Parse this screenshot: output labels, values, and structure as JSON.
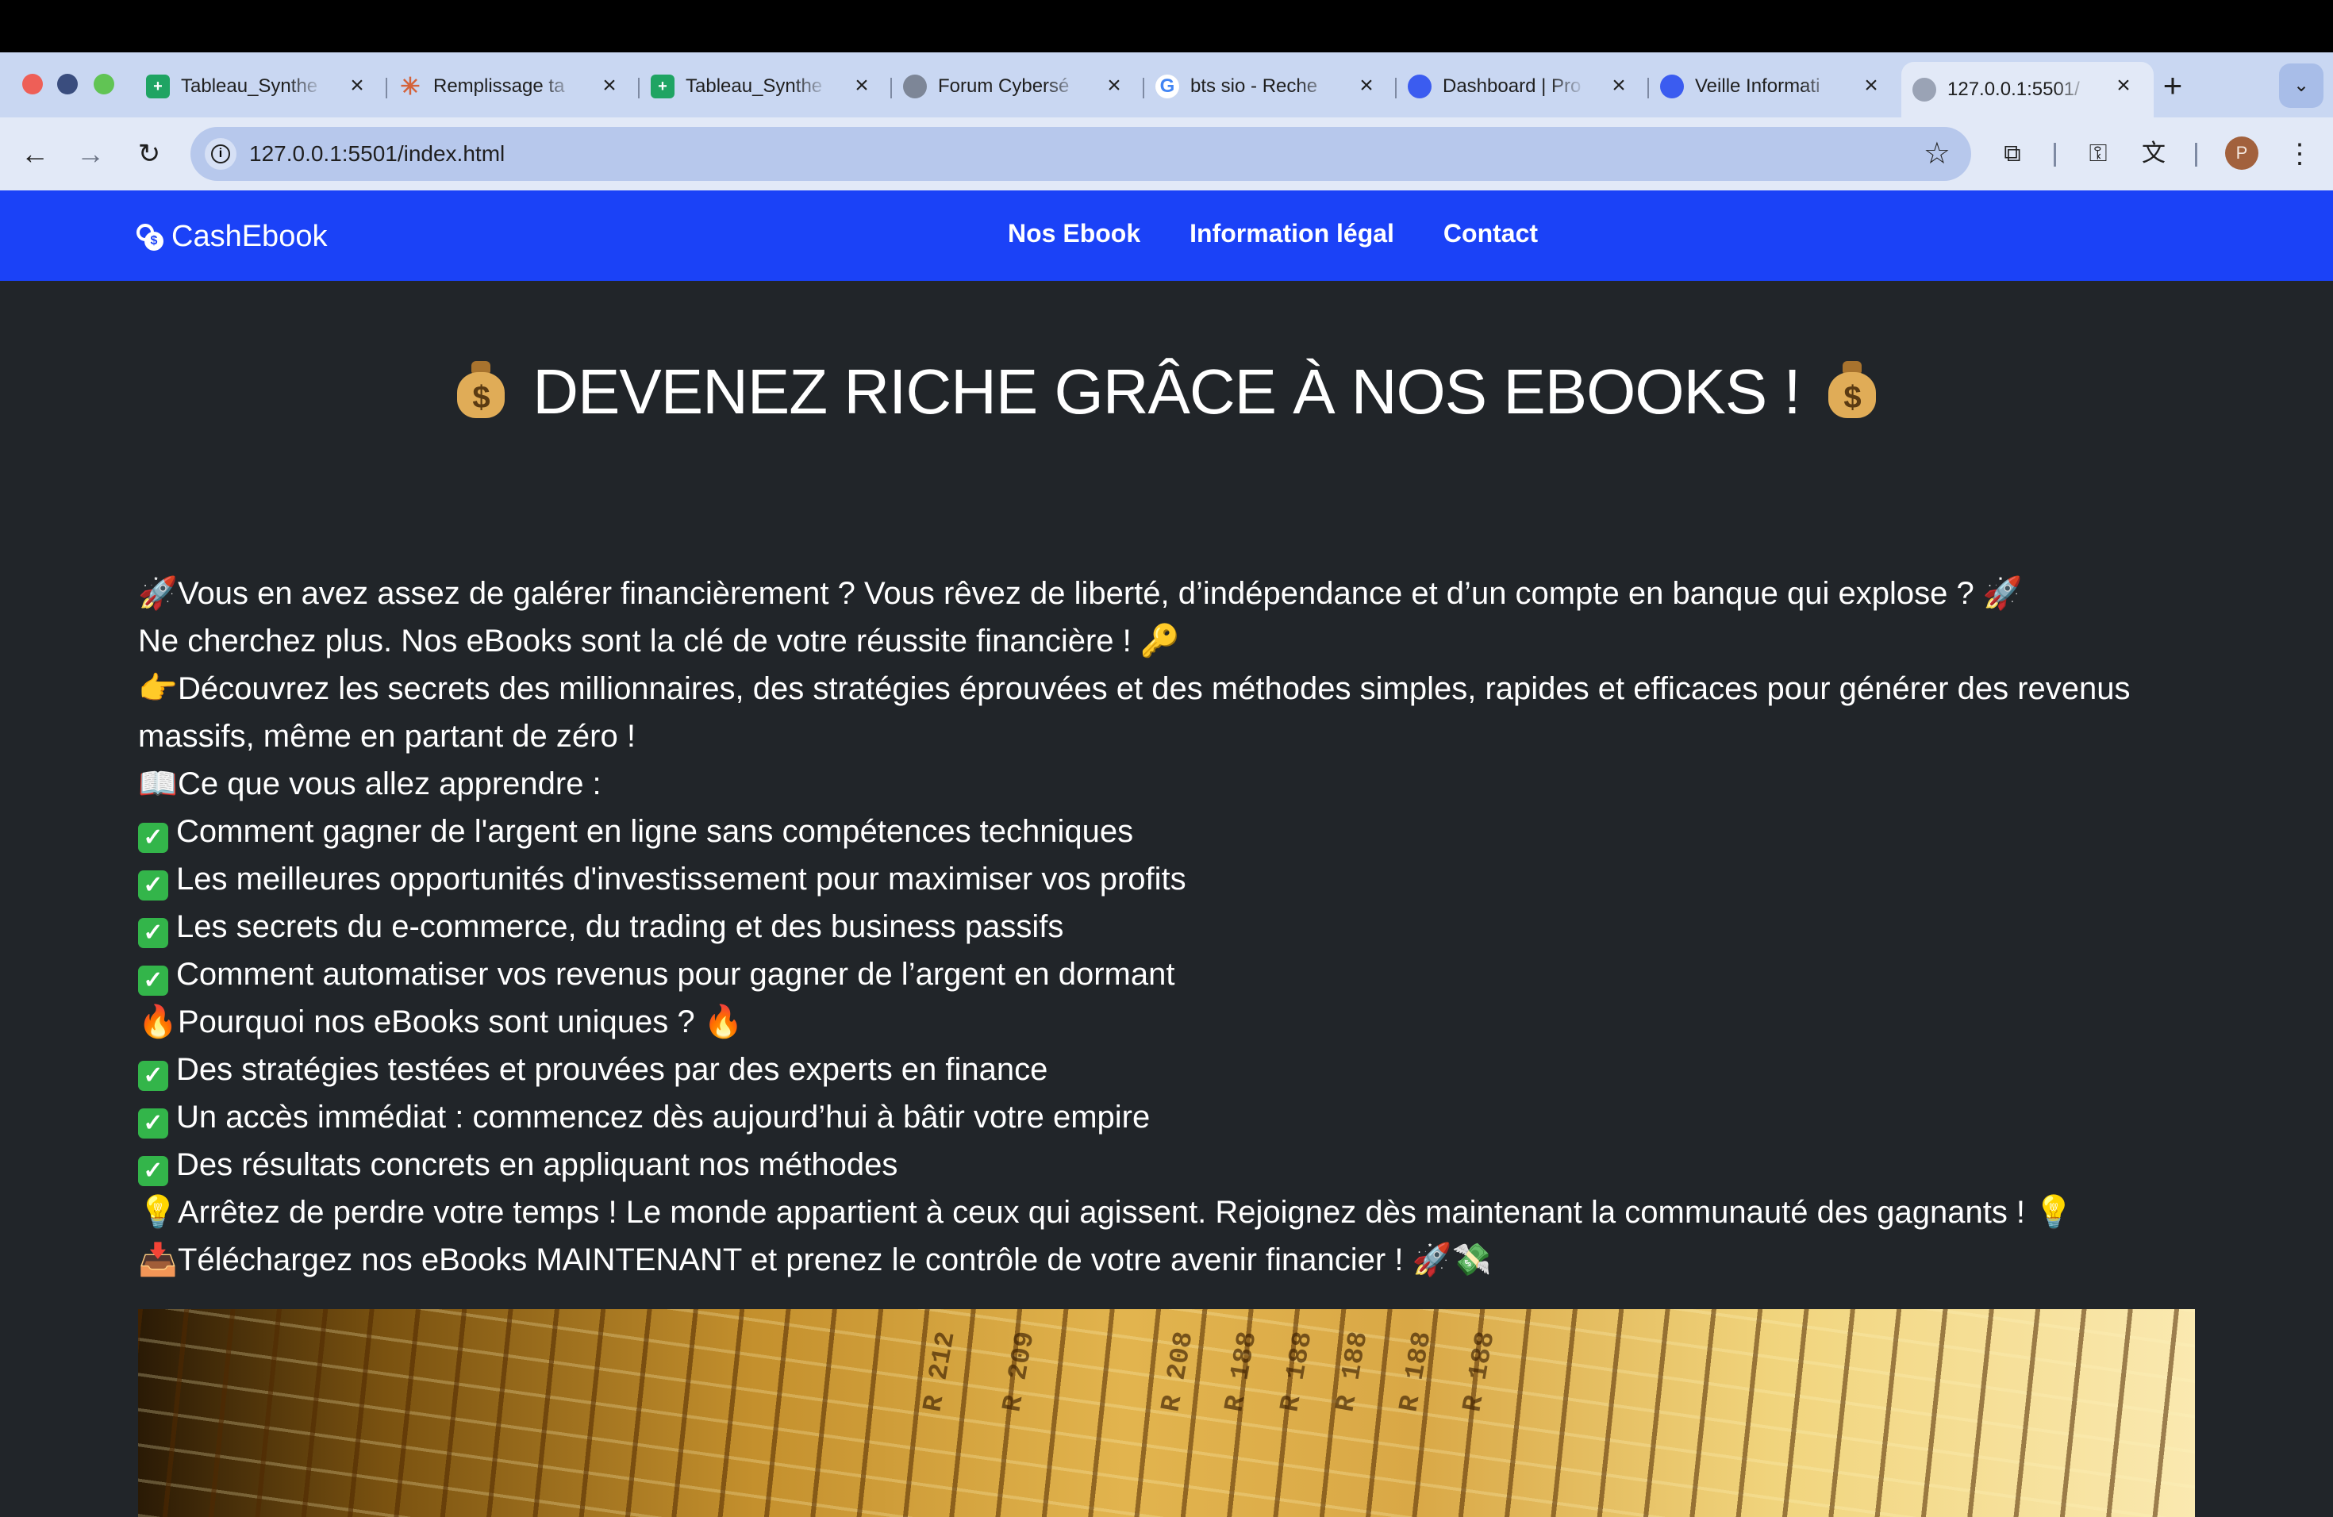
{
  "browser": {
    "tabs": [
      {
        "title": "Tableau_Synthe",
        "icon": "sheets-icon"
      },
      {
        "title": "Remplissage ta",
        "icon": "spark-icon"
      },
      {
        "title": "Tableau_Synthe",
        "icon": "sheets-icon"
      },
      {
        "title": "Forum Cybersé",
        "icon": "globe-icon"
      },
      {
        "title": "bts sio - Reche",
        "icon": "google-icon"
      },
      {
        "title": "Dashboard | Pro",
        "icon": "globe-icon"
      },
      {
        "title": "Veille Informati",
        "icon": "globe-icon"
      },
      {
        "title": "127.0.0.1:5501/",
        "icon": "globe-icon",
        "active": true
      }
    ],
    "url": "127.0.0.1:5501/index.html",
    "profile_initial": "P"
  },
  "site": {
    "brand": "CashEbook",
    "nav": [
      "Nos Ebook",
      "Information légal",
      "Contact"
    ],
    "brand_color": "#1b42f7",
    "background": "#212529"
  },
  "main": {
    "title": "DEVENEZ RICHE GRÂCE À NOS EBOOKS !",
    "lines": [
      "Vous en avez assez de galérer financièrement ? Vous rêvez de liberté, d’indépendance et d’un compte en banque qui explose ?",
      "Ne cherchez plus. Nos eBooks sont la clé de votre réussite financière !",
      "Découvrez les secrets des millionnaires, des stratégies éprouvées et des méthodes simples, rapides et efficaces pour générer des revenus massifs, même en partant de zéro !",
      "Ce que vous allez apprendre :",
      "Comment gagner de l'argent en ligne sans compétences techniques",
      "Les meilleures opportunités d'investissement pour maximiser vos profits",
      "Les secrets du e-commerce, du trading et des business passifs",
      "Comment automatiser vos revenus pour gagner de l’argent en dormant",
      "Pourquoi nos eBooks sont uniques ?",
      "Des stratégies testées et prouvées par des experts en finance",
      "Un accès immédiat : commencez dès aujourd’hui à bâtir votre empire",
      "Des résultats concrets en appliquant nos méthodes",
      "Arrêtez de perdre votre temps ! Le monde appartient à ceux qui agissent. Rejoignez dès maintenant la communauté des gagnants !",
      "Téléchargez nos eBooks MAINTENANT et prenez le contrôle de votre avenir financier !"
    ],
    "image_labels": [
      "R 212",
      "R 209",
      "R 208",
      "R 188",
      "R 188",
      "R 188",
      "R 188",
      "R 188"
    ]
  }
}
